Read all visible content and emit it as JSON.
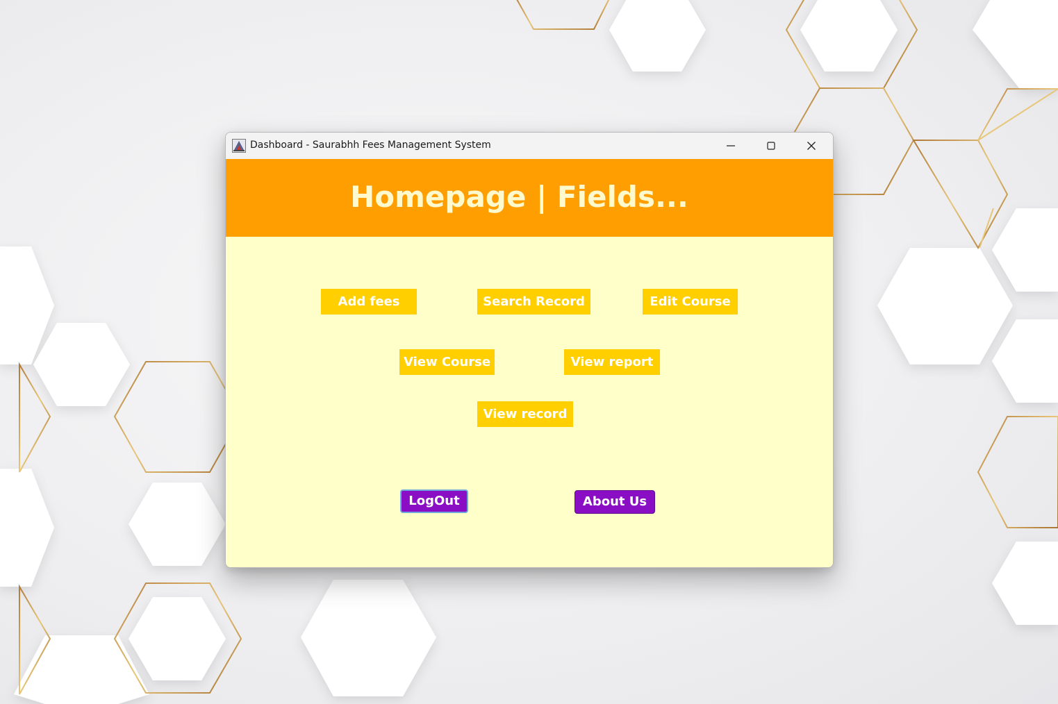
{
  "window": {
    "title": "Dashboard - Saurabhh Fees Management System",
    "controls": [
      "minimize",
      "maximize",
      "close"
    ]
  },
  "header": {
    "title": "Homepage | Fields...",
    "background": "#ff9e00",
    "text_color": "#fffacd"
  },
  "fields": {
    "add_fees": "Add fees",
    "search_record": "Search Record",
    "edit_course": "Edit Course",
    "view_course": "View Course",
    "view_report": "View report",
    "view_record": "View record"
  },
  "actions": {
    "logout": "LogOut",
    "about_us": "About Us"
  },
  "colors": {
    "content_bg": "#ffffc9",
    "field_button": "#ffcf00",
    "action_button": "#8a0fc4"
  }
}
